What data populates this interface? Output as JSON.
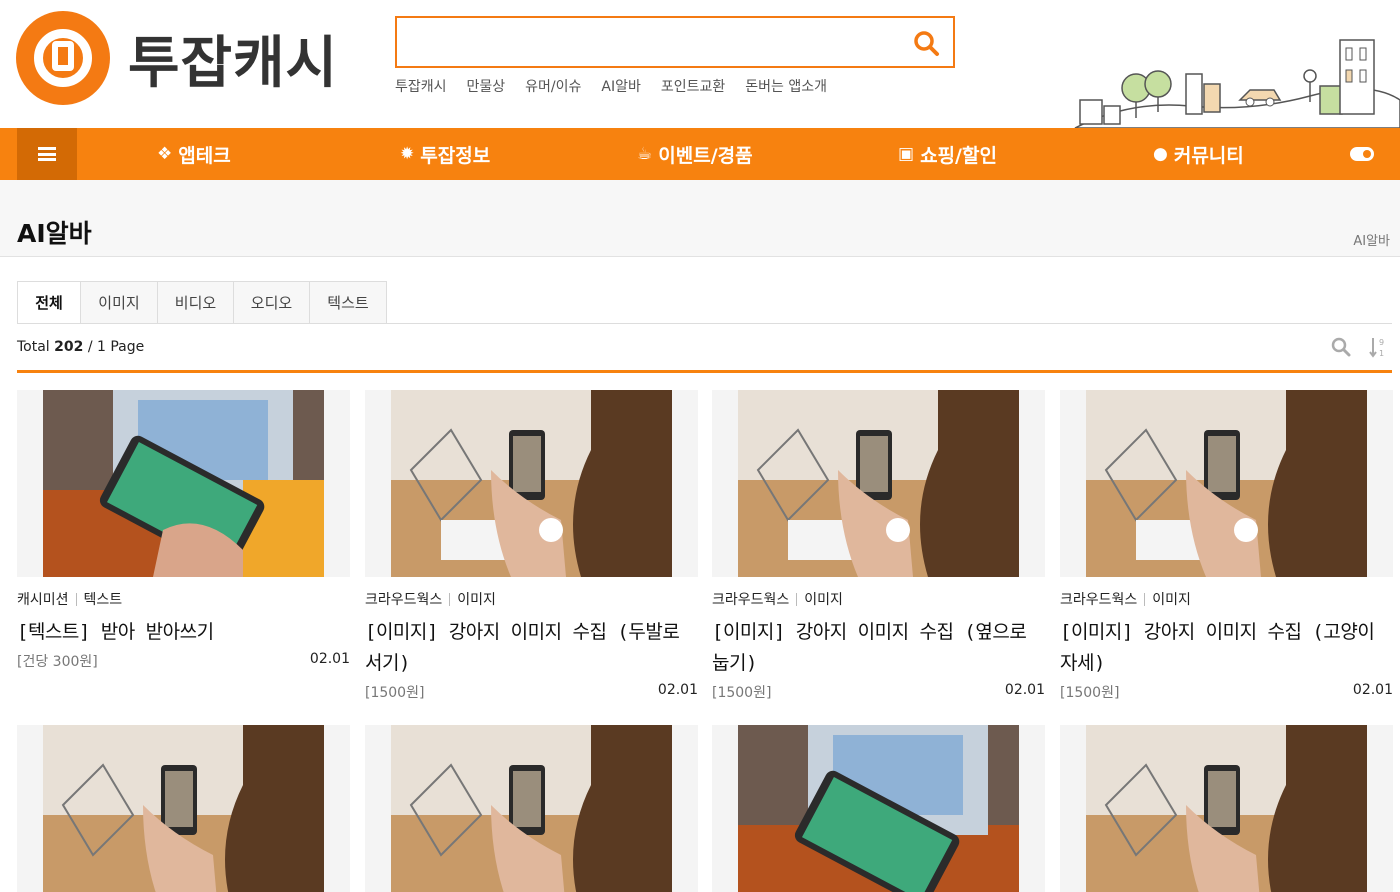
{
  "header": {
    "logo_text": "투잡캐시",
    "search_placeholder": "",
    "quick_links": [
      "투잡캐시",
      "만물상",
      "유머/이슈",
      "AI알바",
      "포인트교환",
      "돈버는 앱소개"
    ]
  },
  "nav": {
    "items": [
      {
        "label": "앱테크",
        "icon": "cubes-icon"
      },
      {
        "label": "투잡정보",
        "icon": "gear-icon"
      },
      {
        "label": "이벤트/경품",
        "icon": "coffee-icon"
      },
      {
        "label": "쇼핑/할인",
        "icon": "shopping-bag-icon"
      },
      {
        "label": "커뮤니티",
        "icon": "comments-icon"
      }
    ],
    "accent": "#f7820f"
  },
  "page": {
    "title": "AI알바",
    "breadcrumb": "AI알바"
  },
  "tabs": [
    "전체",
    "이미지",
    "비디오",
    "오디오",
    "텍스트"
  ],
  "active_tab": "전체",
  "total": {
    "prefix": "Total",
    "count": "202",
    "suffix": "/ 1 Page"
  },
  "cards": [
    {
      "source": "캐시미션",
      "category": "텍스트",
      "title": "[텍스트] 받아 받아쓰기",
      "price": "[건당 300원]",
      "date": "02.01",
      "photo": "laptop"
    },
    {
      "source": "크라우드웍스",
      "category": "이미지",
      "title": "[이미지] 강아지 이미지 수집 (두발로 서기)",
      "price": "[1500원]",
      "date": "02.01",
      "photo": "table"
    },
    {
      "source": "크라우드웍스",
      "category": "이미지",
      "title": "[이미지] 강아지 이미지 수집 (옆으로 눕기)",
      "price": "[1500원]",
      "date": "02.01",
      "photo": "table"
    },
    {
      "source": "크라우드웍스",
      "category": "이미지",
      "title": "[이미지] 강아지 이미지 수집 (고양이 자세)",
      "price": "[1500원]",
      "date": "02.01",
      "photo": "table"
    },
    {
      "source": "",
      "category": "",
      "title": "",
      "price": "",
      "date": "",
      "photo": "table"
    },
    {
      "source": "",
      "category": "",
      "title": "",
      "price": "",
      "date": "",
      "photo": "table"
    },
    {
      "source": "",
      "category": "",
      "title": "",
      "price": "",
      "date": "",
      "photo": "laptop"
    },
    {
      "source": "",
      "category": "",
      "title": "",
      "price": "",
      "date": "",
      "photo": "table"
    }
  ]
}
